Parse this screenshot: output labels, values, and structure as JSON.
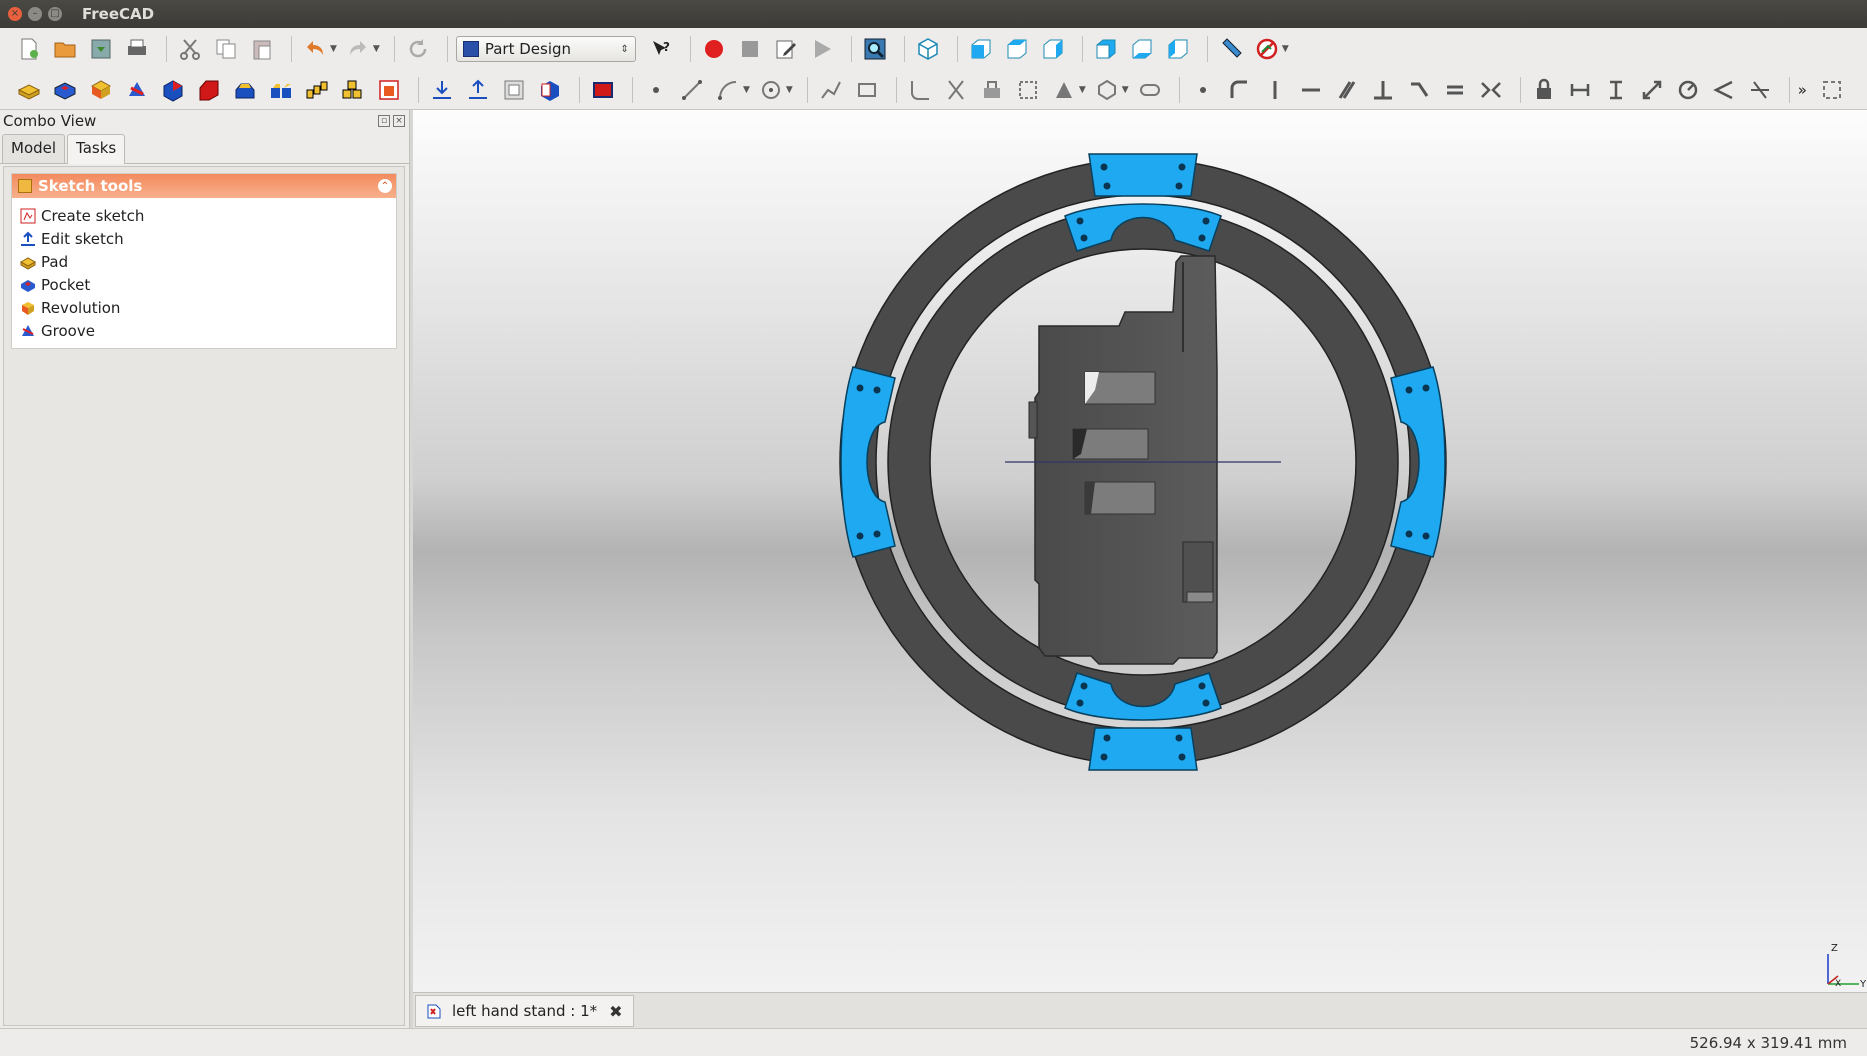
{
  "window": {
    "title": "FreeCAD"
  },
  "toolbar1": {
    "workbench": "Part Design",
    "icons": [
      "new-file-icon",
      "open-file-icon",
      "save-icon",
      "print-icon",
      "cut-icon",
      "copy-icon",
      "paste-icon",
      "undo-icon",
      "redo-icon",
      "refresh-icon",
      "whats-this-icon",
      "record-macro-icon",
      "stop-macro-icon",
      "edit-macro-icon",
      "execute-macro-icon",
      "fit-all-icon",
      "isometric-view-icon",
      "front-view-icon",
      "top-view-icon",
      "right-view-icon",
      "rear-view-icon",
      "bottom-view-icon",
      "left-view-icon",
      "measure-distance-icon",
      "clear-measure-icon"
    ]
  },
  "toolbar2": {
    "icons": [
      "pad-icon",
      "pocket-icon",
      "revolution-icon",
      "groove-icon",
      "fillet-icon",
      "chamfer-icon",
      "draft-icon",
      "mirrored-icon",
      "linear-pattern-icon",
      "polar-pattern-icon",
      "multitransform-icon",
      "new-sketch-icon",
      "edit-sketch-icon",
      "map-sketch-icon",
      "validate-sketch-icon",
      "leave-sketch-icon",
      "point-icon",
      "line-icon",
      "arc-icon",
      "circle-icon",
      "polyline-icon",
      "rectangle-icon",
      "fillet-sketch-icon",
      "trim-icon",
      "external-geometry-icon",
      "construction-icon",
      "conic-icon",
      "polygon-icon",
      "slot-icon",
      "coincident-icon",
      "point-on-object-icon",
      "vertical-icon",
      "horizontal-icon",
      "parallel-icon",
      "perpendicular-icon",
      "tangent-icon",
      "equal-icon",
      "symmetric-icon",
      "lock-icon",
      "horizontal-distance-icon",
      "vertical-distance-icon",
      "distance-icon",
      "radius-icon",
      "angle-icon",
      "snell-icon",
      "more-icon",
      "toggle-icon"
    ]
  },
  "combo": {
    "title": "Combo View",
    "tabs": [
      "Model",
      "Tasks"
    ],
    "panel_title": "Sketch tools",
    "tasks": [
      {
        "label": "Create sketch",
        "icon": "create-sketch-icon"
      },
      {
        "label": "Edit sketch",
        "icon": "edit-sketch-icon"
      },
      {
        "label": "Pad",
        "icon": "pad-icon"
      },
      {
        "label": "Pocket",
        "icon": "pocket-icon"
      },
      {
        "label": "Revolution",
        "icon": "revolution-icon"
      },
      {
        "label": "Groove",
        "icon": "groove-icon"
      }
    ]
  },
  "colors": {
    "accent": "#1ea9f0",
    "ring": "#4a4a4a",
    "panel_header": "#f48a5e"
  },
  "document_tab": {
    "label": "left hand stand : 1*"
  },
  "axis": {
    "z": "Z",
    "x": "X",
    "y": "Y"
  },
  "status": {
    "dimensions": "526.94 x 319.41 mm"
  }
}
